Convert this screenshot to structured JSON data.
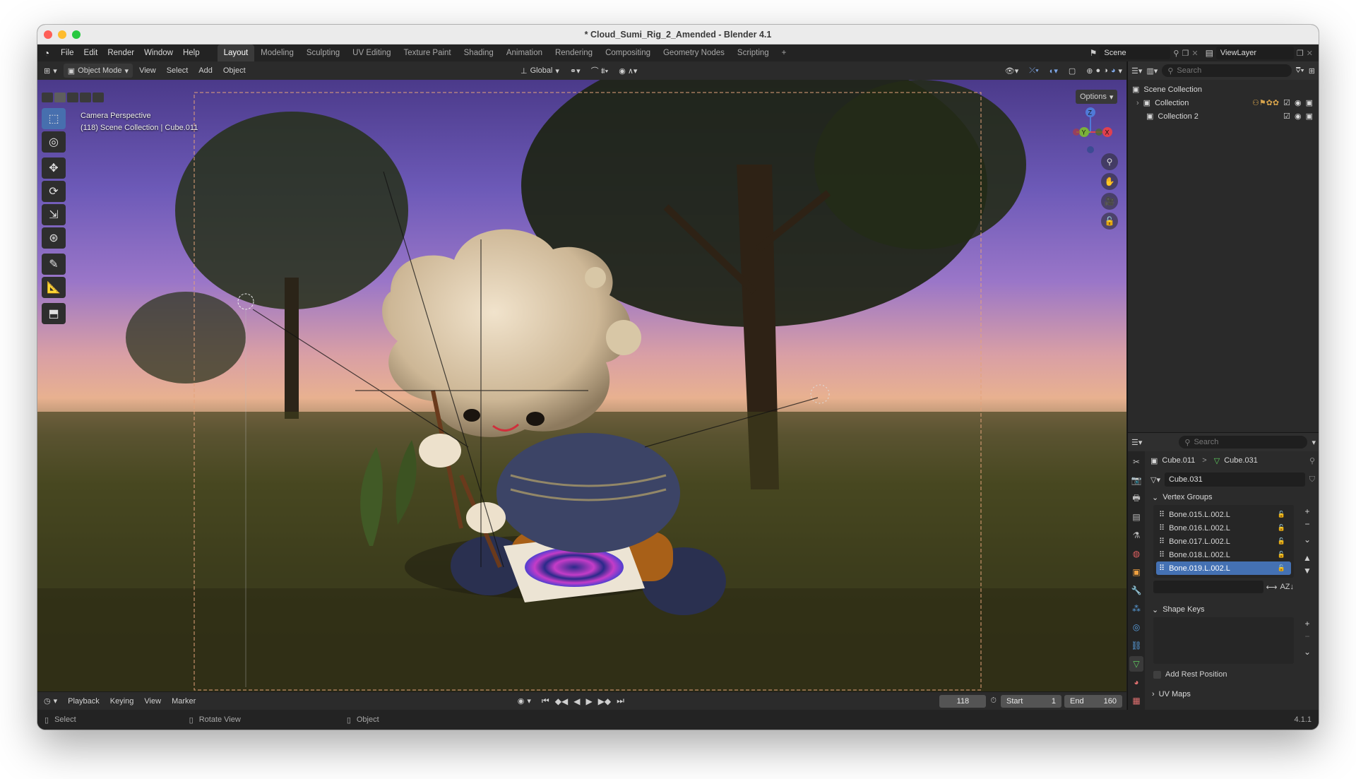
{
  "window": {
    "title": "* Cloud_Sumi_Rig_2_Amended - Blender 4.1"
  },
  "menu": [
    "File",
    "Edit",
    "Render",
    "Window",
    "Help"
  ],
  "workspaces": [
    "Layout",
    "Modeling",
    "Sculpting",
    "UV Editing",
    "Texture Paint",
    "Shading",
    "Animation",
    "Rendering",
    "Compositing",
    "Geometry Nodes",
    "Scripting"
  ],
  "workspace_add": "+",
  "scene": {
    "name": "Scene",
    "view_layer": "ViewLayer"
  },
  "viewport_header": {
    "mode": "Object Mode",
    "menus": [
      "View",
      "Select",
      "Add",
      "Object"
    ],
    "orientation": "Global",
    "options": "Options"
  },
  "viewport": {
    "line1": "Camera Perspective",
    "line2": "(118) Scene Collection | Cube.011",
    "gizmo": {
      "z": "Z",
      "x": "X",
      "y": "Y"
    }
  },
  "tools": [
    "select-box-icon",
    "cursor-icon",
    "move-icon",
    "rotate-icon",
    "scale-icon",
    "transform-icon",
    "annotate-icon",
    "measure-icon",
    "add-cube-icon"
  ],
  "outliner": {
    "search_placeholder": "Search",
    "root": "Scene Collection",
    "items": [
      "Collection",
      "Collection 2"
    ]
  },
  "properties": {
    "search_placeholder": "Search",
    "breadcrumb_object": "Cube.011",
    "breadcrumb_sep": ">",
    "breadcrumb_data": "Cube.031",
    "mesh_name": "Cube.031",
    "vertex_groups_title": "Vertex Groups",
    "vertex_groups": [
      "Bone.015.L.002.L",
      "Bone.016.L.002.L",
      "Bone.017.L.002.L",
      "Bone.018.L.002.L",
      "Bone.019.L.002.L"
    ],
    "selected_index": 4,
    "shape_keys_title": "Shape Keys",
    "add_rest_position": "Add Rest Position",
    "uv_maps_title": "UV Maps"
  },
  "timeline": {
    "menus": [
      "Playback",
      "Keying",
      "View",
      "Marker"
    ],
    "current_frame": "118",
    "start_label": "Start",
    "start_value": "1",
    "end_label": "End",
    "end_value": "160"
  },
  "status": {
    "select": "Select",
    "rotate": "Rotate View",
    "object": "Object",
    "version": "4.1.1"
  },
  "colors": {
    "accent": "#4471b3",
    "selection": "#476fae"
  }
}
